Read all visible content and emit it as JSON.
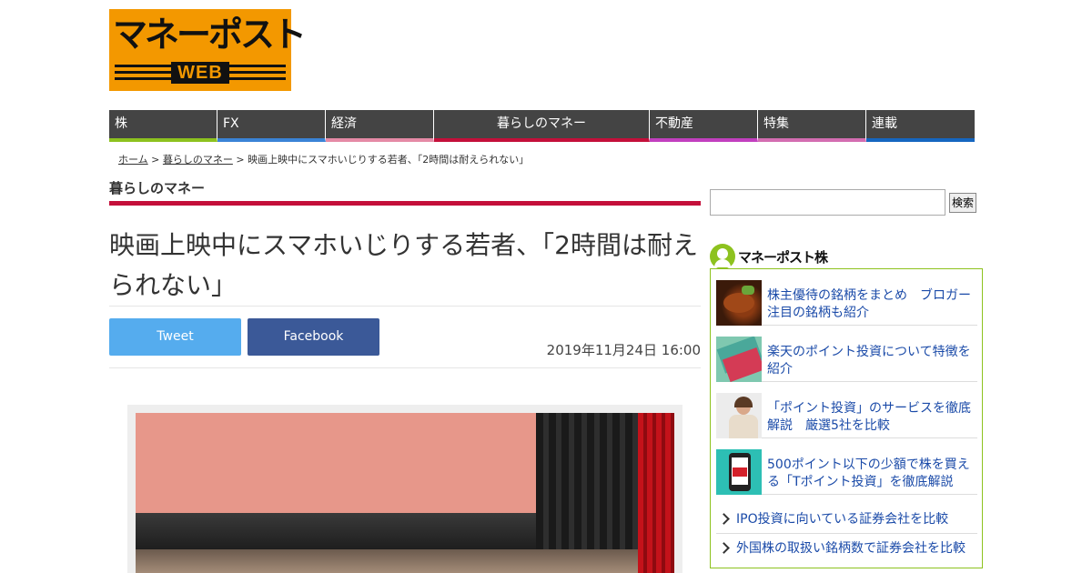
{
  "site": {
    "logo_main": "マネーポスト",
    "logo_sub": "WEB"
  },
  "nav": {
    "items": [
      {
        "label": "株",
        "color": "#8dc21f",
        "width": 119,
        "center": false
      },
      {
        "label": "FX",
        "color": "#3a83d6",
        "width": 119,
        "center": false
      },
      {
        "label": "経済",
        "color": "#e58aa6",
        "width": 119,
        "center": false
      },
      {
        "label": "暮らしのマネー",
        "color": "#c40f3a",
        "width": 237,
        "center": true
      },
      {
        "label": "不動産",
        "color": "#c23fbf",
        "width": 119,
        "center": false
      },
      {
        "label": "特集",
        "color": "#d36db1",
        "width": 119,
        "center": false
      },
      {
        "label": "連載",
        "color": "#1566c0",
        "width": 119,
        "center": false
      }
    ]
  },
  "breadcrumb": {
    "home": "ホーム",
    "sep": " > ",
    "category": "暮らしのマネー",
    "current": "映画上映中にスマホいじりする若者、「2時間は耐えられない」"
  },
  "article": {
    "category": "暮らしのマネー",
    "title": "映画上映中にスマホいじりする若者、「2時間は耐えられない」",
    "date": "2019年11月24日 16:00",
    "tweet_label": "Tweet",
    "facebook_label": "Facebook",
    "accent_color": "#c40f3a"
  },
  "search": {
    "value": "",
    "button_label": "検索"
  },
  "sidebar": {
    "widget_title": "マネーポスト株",
    "accent_color": "#8dc21f",
    "articles": [
      {
        "text": "株主優待の銘柄をまとめ　ブロガー注目の銘柄も紹介",
        "thumb_icon": "food-dish-icon"
      },
      {
        "text": "楽天のポイント投資について特徴を紹介",
        "thumb_icon": "point-card-icon"
      },
      {
        "text": "「ポイント投資」のサービスを徹底解説　厳選5社を比較",
        "thumb_icon": "woman-laptop-icon"
      },
      {
        "text": "500ポイント以下の少額で株を買える「Tポイント投資」を徹底解説",
        "thumb_icon": "phone-buy-icon"
      }
    ],
    "links": [
      "IPO投資に向いている証券会社を比較",
      "外国株の取扱い銘柄数で証券会社を比較"
    ]
  }
}
